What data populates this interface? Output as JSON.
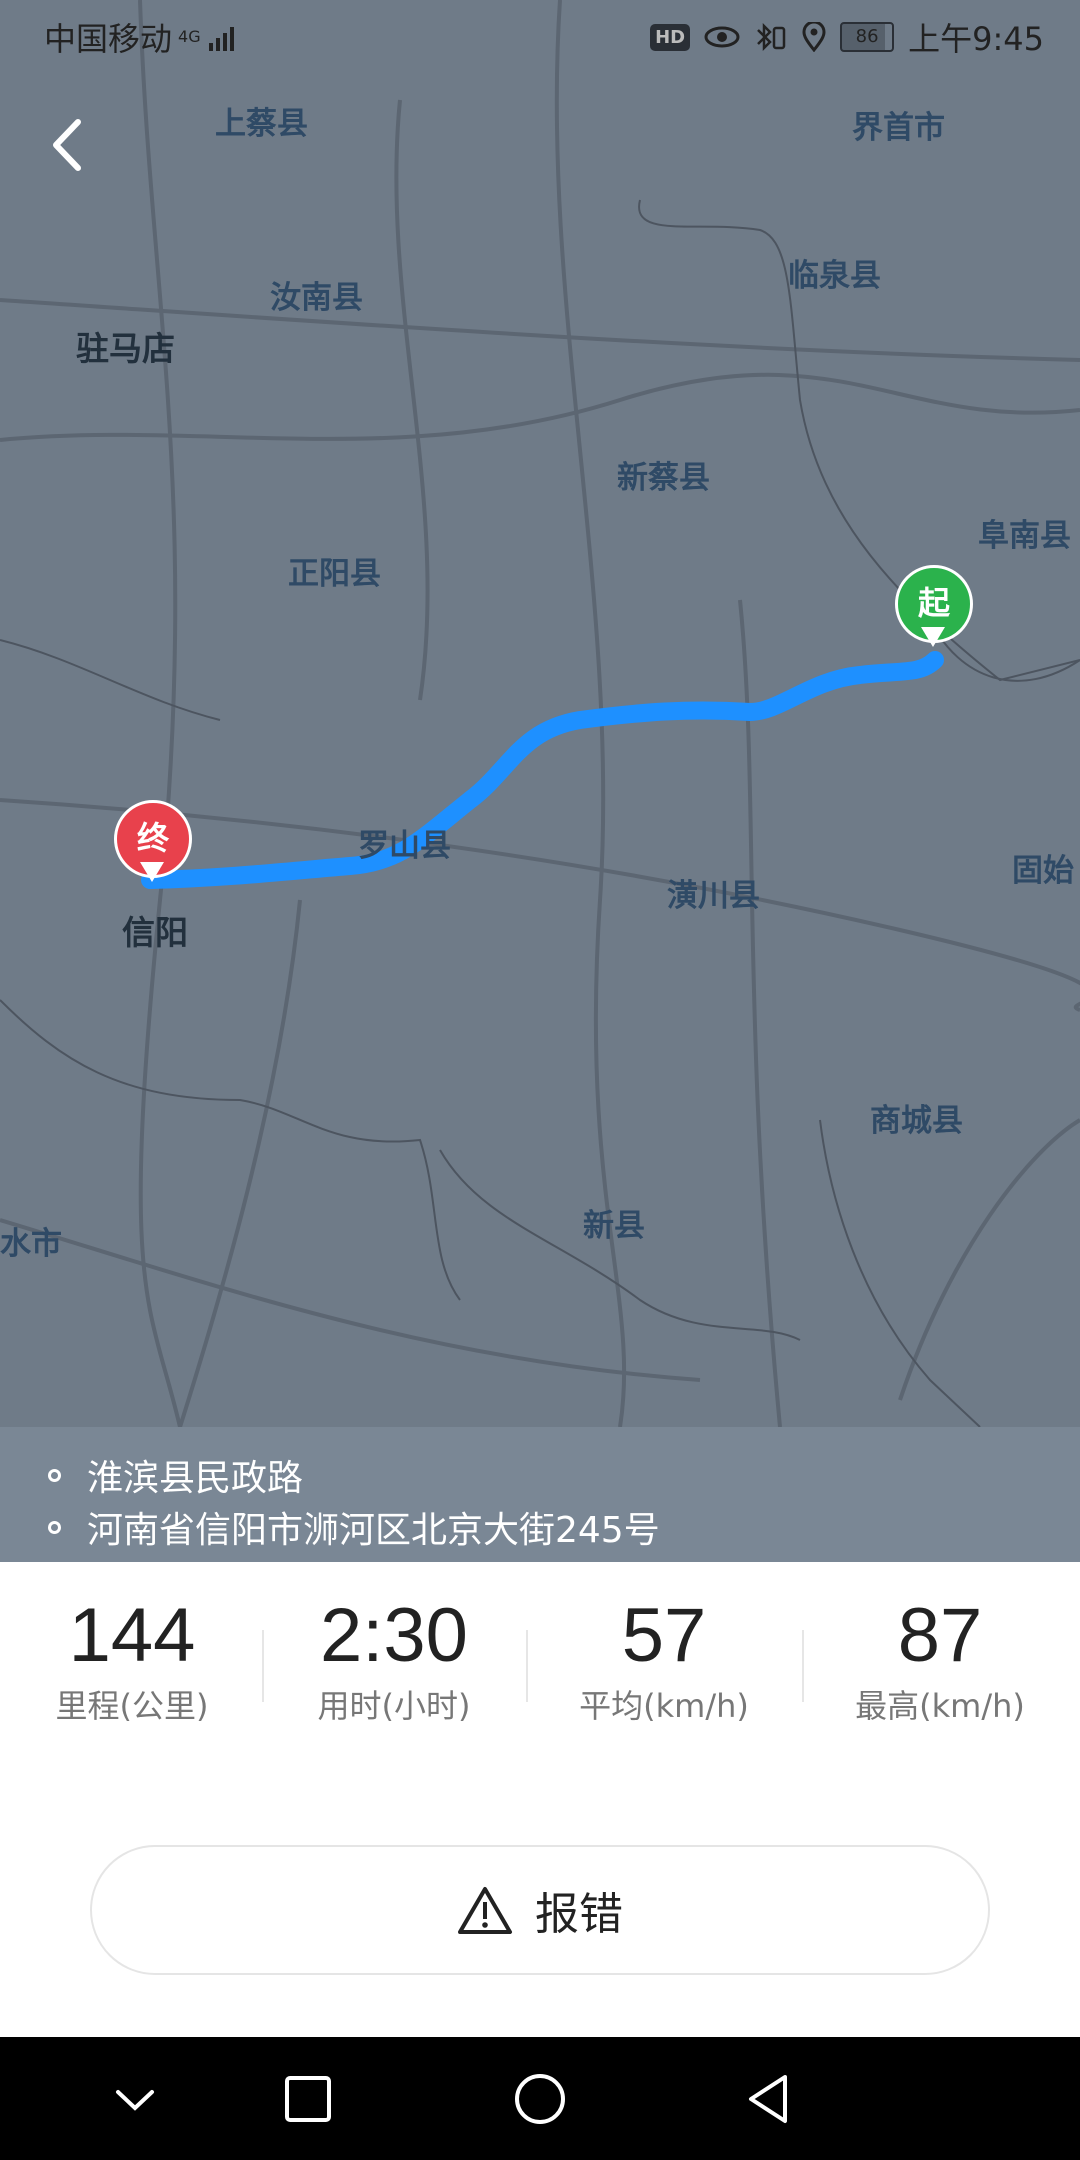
{
  "status_bar": {
    "carrier": "中国移动",
    "network": "4G",
    "hd": "HD",
    "battery": "86",
    "time": "上午9:45"
  },
  "map": {
    "places": {
      "shangcai": "上蔡县",
      "jieshou": "界首市",
      "runan": "汝南县",
      "linquan": "临泉县",
      "zhumadian": "驻马店",
      "xincai": "新蔡县",
      "funan": "阜南县",
      "zhengyang": "正阳县",
      "luoshan": "罗山县",
      "huangchuan": "潢川县",
      "gushi": "固始",
      "xinyang": "信阳",
      "shangcheng": "商城县",
      "xinxian": "新县",
      "shuishi": "水市"
    },
    "start_label": "起",
    "end_label": "终",
    "route_color": "#1e90ff"
  },
  "addresses": {
    "start": "淮滨县民政路",
    "end": "河南省信阳市浉河区北京大街245号"
  },
  "stats": [
    {
      "value": "144",
      "label": "里程(公里)"
    },
    {
      "value": "2:30",
      "label": "用时(小时)"
    },
    {
      "value": "57",
      "label": "平均(km/h)"
    },
    {
      "value": "87",
      "label": "最高(km/h)"
    }
  ],
  "report_button": "报错",
  "battery_level": 0.86
}
